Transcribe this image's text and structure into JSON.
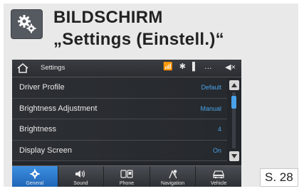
{
  "card": {
    "title_line1": "BILDSCHIRM",
    "title_line2": "„Settings (Einstell.)“",
    "page_ref": "S. 28"
  },
  "screen": {
    "title": "Settings",
    "rows": [
      {
        "label": "Driver Profile",
        "value": "Default"
      },
      {
        "label": "Brightness Adjustment",
        "value": "Manual"
      },
      {
        "label": "Brightness",
        "value": "4"
      },
      {
        "label": "Display Screen",
        "value": "On"
      }
    ],
    "tabs": [
      {
        "label": "General",
        "icon": "gear-icon",
        "active": true
      },
      {
        "label": "Sound",
        "icon": "speaker-icon",
        "active": false
      },
      {
        "label": "Phone",
        "icon": "phone-icon",
        "active": false
      },
      {
        "label": "Navigation",
        "icon": "navigation-icon",
        "active": false
      },
      {
        "label": "Vehicle",
        "icon": "car-icon",
        "active": false
      }
    ],
    "status_icons": [
      "wifi-icon",
      "bluetooth-icon",
      "battery-icon",
      "signal-icon",
      "mute-icon"
    ]
  },
  "colors": {
    "accent": "#4aa2ea",
    "active_tab": "#2a78cc",
    "screen_bg": "#23262b",
    "card_bg": "#e9e9e9"
  }
}
